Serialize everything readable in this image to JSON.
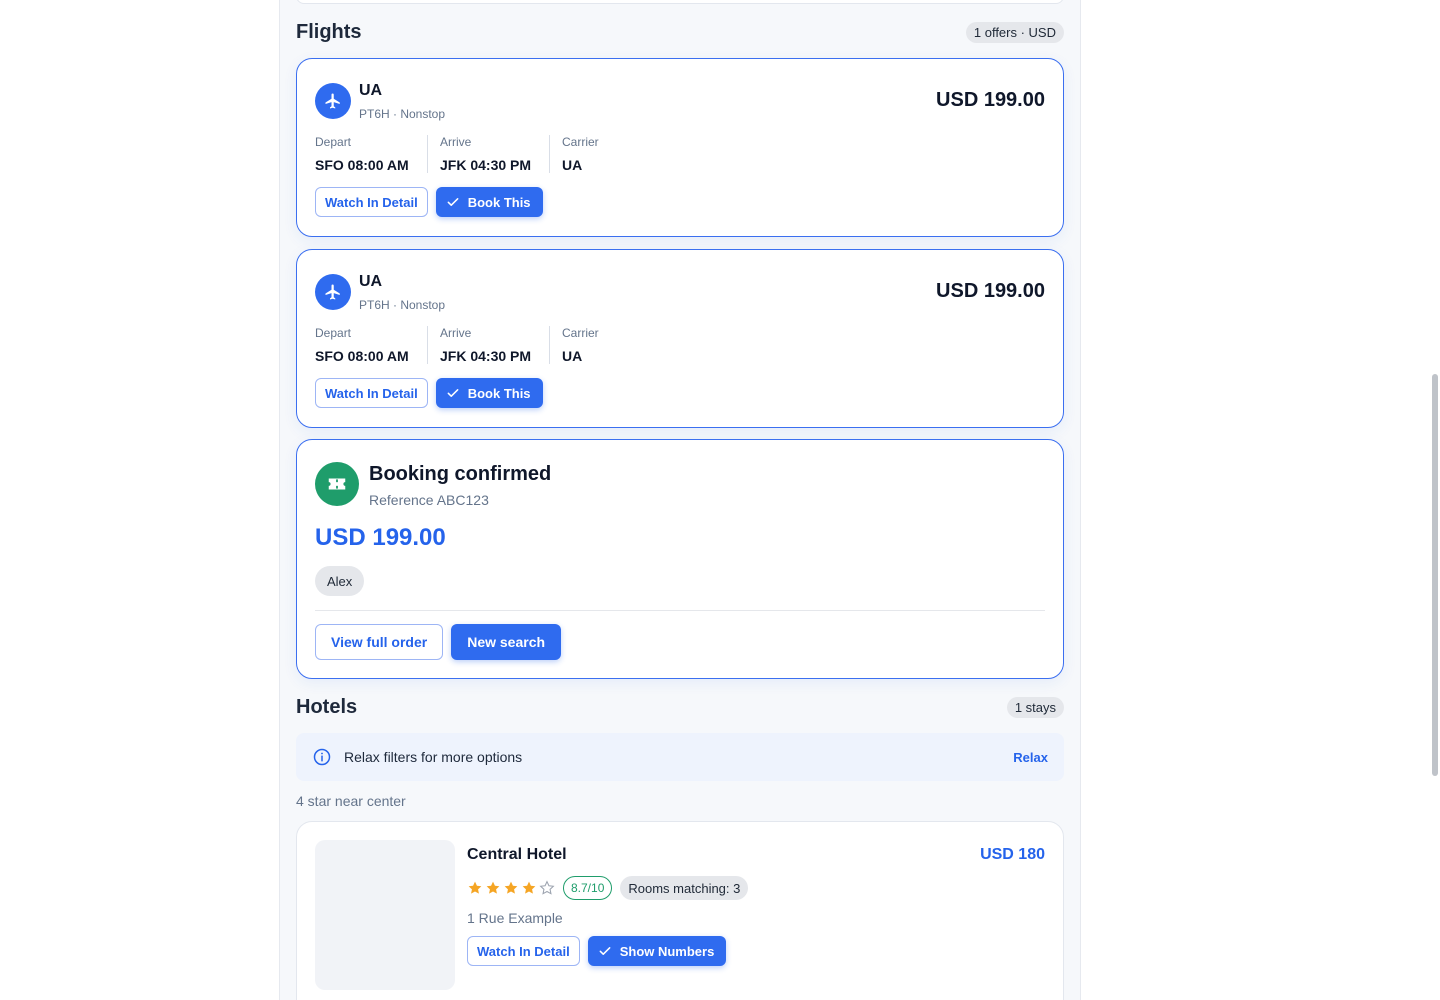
{
  "flights": {
    "title": "Flights",
    "badge": "1 offers · USD",
    "offers": [
      {
        "airline": "UA",
        "sub": "PT6H · Nonstop",
        "price": "USD 199.00",
        "depart_label": "Depart",
        "depart_value": "SFO 08:00 AM",
        "arrive_label": "Arrive",
        "arrive_value": "JFK 04:30 PM",
        "carrier_label": "Carrier",
        "carrier_value": "UA",
        "detail_label": "Watch In Detail",
        "book_label": "Book This"
      },
      {
        "airline": "UA",
        "sub": "PT6H · Nonstop",
        "price": "USD 199.00",
        "depart_label": "Depart",
        "depart_value": "SFO 08:00 AM",
        "arrive_label": "Arrive",
        "arrive_value": "JFK 04:30 PM",
        "carrier_label": "Carrier",
        "carrier_value": "UA",
        "detail_label": "Watch In Detail",
        "book_label": "Book This"
      }
    ]
  },
  "booking": {
    "title": "Booking confirmed",
    "reference": "Reference ABC123",
    "total": "USD 199.00",
    "traveler": "Alex",
    "view_order_label": "View full order",
    "new_search_label": "New search"
  },
  "hotels": {
    "title": "Hotels",
    "badge": "1 stays",
    "info_message": "Relax filters for more options",
    "relax_label": "Relax",
    "query": "4 star near center",
    "items": [
      {
        "name": "Central Hotel",
        "price": "USD 180",
        "stars": 4,
        "max_stars": 5,
        "score": "8.7/10",
        "rooms": "Rooms matching: 3",
        "address": "1 Rue Example",
        "detail_label": "Watch In Detail",
        "numbers_label": "Show Numbers"
      }
    ]
  },
  "colors": {
    "accent": "#2f6bef",
    "success": "#1f9d6b",
    "star": "#f5a524"
  }
}
